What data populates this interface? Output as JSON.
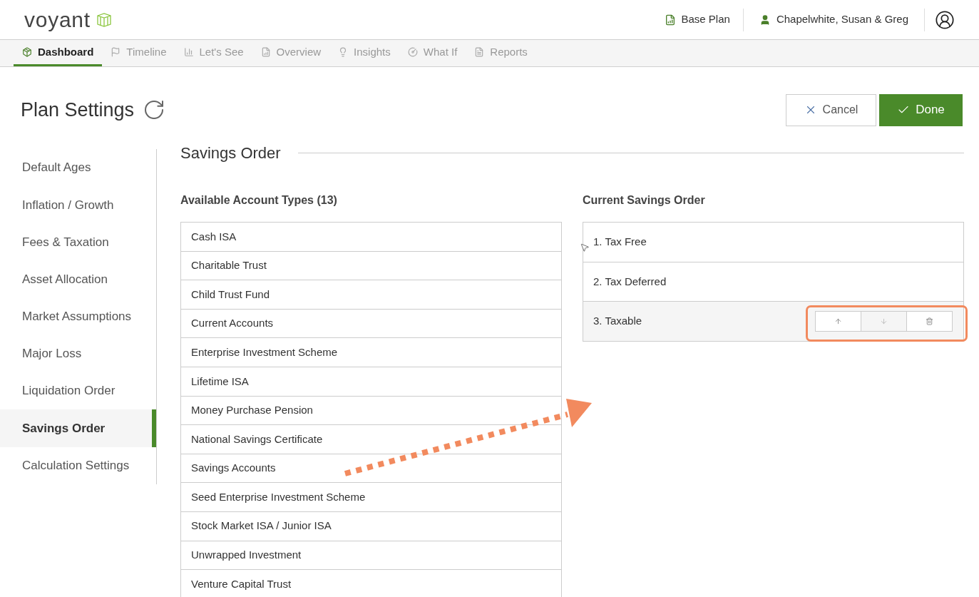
{
  "header": {
    "logo": "voyant",
    "plan": "Base Plan",
    "client": "Chapelwhite, Susan & Greg"
  },
  "nav_tabs": [
    {
      "label": "Dashboard",
      "selected": true
    },
    {
      "label": "Timeline",
      "selected": false
    },
    {
      "label": "Let's See",
      "selected": false
    },
    {
      "label": "Overview",
      "selected": false
    },
    {
      "label": "Insights",
      "selected": false
    },
    {
      "label": "What If",
      "selected": false
    },
    {
      "label": "Reports",
      "selected": false
    }
  ],
  "page_title": "Plan Settings",
  "buttons": {
    "cancel": "Cancel",
    "done": "Done"
  },
  "sidebar": {
    "items": [
      {
        "label": "Default Ages",
        "selected": false
      },
      {
        "label": "Inflation / Growth",
        "selected": false
      },
      {
        "label": "Fees & Taxation",
        "selected": false
      },
      {
        "label": "Asset Allocation",
        "selected": false
      },
      {
        "label": "Market Assumptions",
        "selected": false
      },
      {
        "label": "Major Loss",
        "selected": false
      },
      {
        "label": "Liquidation Order",
        "selected": false
      },
      {
        "label": "Savings Order",
        "selected": true
      },
      {
        "label": "Calculation Settings",
        "selected": false
      }
    ]
  },
  "section_title": "Savings Order",
  "available": {
    "title": "Available Account Types (13)",
    "items": [
      "Cash ISA",
      "Charitable Trust",
      "Child Trust Fund",
      "Current Accounts",
      "Enterprise Investment Scheme",
      "Lifetime ISA",
      "Money Purchase Pension",
      "National Savings Certificate",
      "Savings Accounts",
      "Seed Enterprise Investment Scheme",
      "Stock Market ISA / Junior ISA",
      "Unwrapped Investment",
      "Venture Capital Trust"
    ]
  },
  "current": {
    "title": "Current Savings Order",
    "items": [
      {
        "label": "1. Tax Free",
        "selected": false
      },
      {
        "label": "2. Tax Deferred",
        "selected": false
      },
      {
        "label": "3. Taxable",
        "selected": true
      }
    ],
    "actions": [
      {
        "kind": "up",
        "disabled": false
      },
      {
        "kind": "down",
        "disabled": true
      },
      {
        "kind": "delete",
        "disabled": false
      }
    ]
  }
}
